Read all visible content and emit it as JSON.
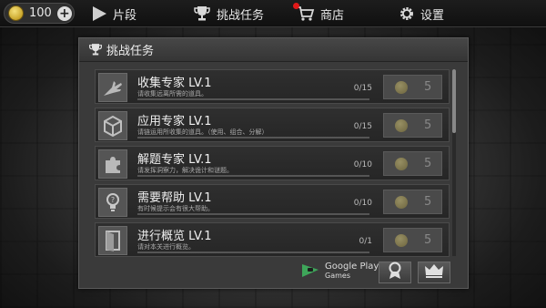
{
  "topbar": {
    "coins": "100",
    "scenes_label": "片段",
    "challenges_label": "挑战任务",
    "shop_label": "商店",
    "settings_label": "设置"
  },
  "panel": {
    "title": "挑战任务"
  },
  "missions": [
    {
      "title": "收集专家 LV.1",
      "desc": "请收集远离所需的道具。",
      "progress": "0/15",
      "reward": "5",
      "icon": "hand-icon"
    },
    {
      "title": "应用专家 LV.1",
      "desc": "请链运用所收集的道具。（使用、组合、分解）",
      "progress": "0/15",
      "reward": "5",
      "icon": "box-icon"
    },
    {
      "title": "解题专家 LV.1",
      "desc": "请发挥洞察力，解决诡计和谜题。",
      "progress": "0/10",
      "reward": "5",
      "icon": "puzzle-icon"
    },
    {
      "title": "需要帮助 LV.1",
      "desc": "有时候提示会有很大帮助。",
      "progress": "0/10",
      "reward": "5",
      "icon": "lightbulb-icon"
    },
    {
      "title": "进行概览 LV.1",
      "desc": "请对本关进行概览。",
      "progress": "0/1",
      "reward": "5",
      "icon": "door-icon"
    }
  ],
  "footer": {
    "gpg_line1": "Google Play",
    "gpg_line2": "Games"
  },
  "colors": {
    "panel_bg": "#3a3a3a",
    "coin_gold": "#c9a52a",
    "badge_red": "#e01818"
  }
}
